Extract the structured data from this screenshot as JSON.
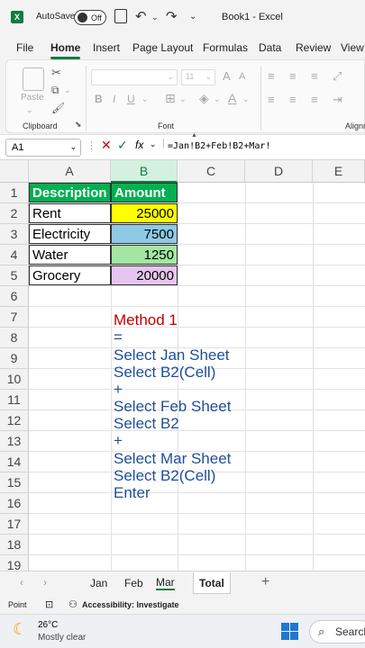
{
  "titlebar": {
    "autosave_label": "AutoSave",
    "toggle_state": "Off",
    "window_title": "Book1  -  Excel"
  },
  "menu": {
    "tabs": [
      "File",
      "Home",
      "Insert",
      "Page Layout",
      "Formulas",
      "Data",
      "Review",
      "View"
    ],
    "active": "Home"
  },
  "ribbon": {
    "paste_label": "Paste",
    "clipboard_label": "Clipboard",
    "font_label": "Font",
    "alignment_label": "Alignm",
    "font_size": "11"
  },
  "formula_bar": {
    "name_box": "A1",
    "fx_label": "fx",
    "formula": "=Jan!B2+Feb!B2+Mar!"
  },
  "columns": [
    "A",
    "B",
    "C",
    "D",
    "E"
  ],
  "rows": [
    "1",
    "2",
    "3",
    "4",
    "5",
    "6",
    "7",
    "8",
    "9",
    "10",
    "11",
    "12",
    "13",
    "14",
    "15",
    "16",
    "17",
    "18",
    "19"
  ],
  "table": {
    "header": [
      "Description",
      "Amount"
    ],
    "rows": [
      {
        "desc": "Rent",
        "amount": "25000",
        "color": "#ffff00"
      },
      {
        "desc": "Electricity",
        "amount": "7500",
        "color": "#8ecae6"
      },
      {
        "desc": "Water",
        "amount": "1250",
        "color": "#a3e6a3"
      },
      {
        "desc": "Grocery",
        "amount": "20000",
        "color": "#e6c6f0"
      }
    ],
    "header_color": "#00b050"
  },
  "notes": [
    "Method 1",
    "=",
    "Select Jan Sheet",
    "Select B2(Cell)",
    "+",
    "Select Feb Sheet",
    "Select B2",
    "+",
    "Select Mar Sheet",
    "Select B2(Cell)",
    "Enter"
  ],
  "sheets": [
    "Jan",
    "Feb",
    "Mar",
    "Total"
  ],
  "active_sheet": "Mar",
  "status": {
    "mode": "Point",
    "accessibility": "Accessibility: Investigate"
  },
  "taskbar": {
    "temperature": "26°C",
    "weather": "Mostly clear",
    "search": "Search"
  }
}
